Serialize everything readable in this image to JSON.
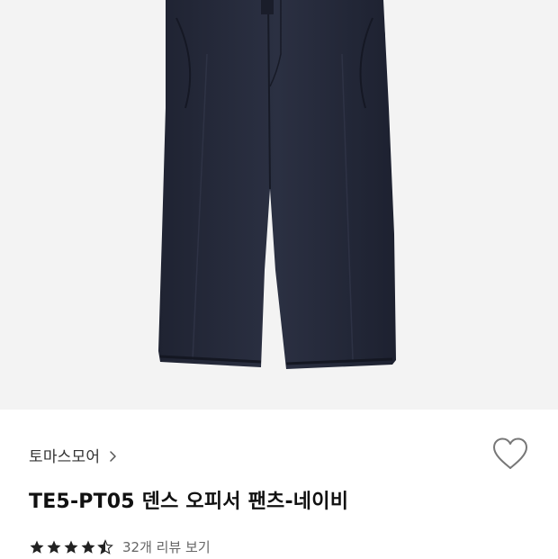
{
  "product": {
    "brand": "토마스모어",
    "title": "TE5-PT05 덴스 오피서 팬츠-네이비",
    "rating": 4.5,
    "rating_max": 5,
    "review_link": "32개 리뷰 보기"
  },
  "colors": {
    "pants": "#262a3a",
    "image_background": "#f3f3f3",
    "star": "#222222"
  },
  "icons": {
    "wishlist": "heart-outline-icon",
    "brand_link": "chevron-right-icon",
    "rating": "star-icon"
  }
}
